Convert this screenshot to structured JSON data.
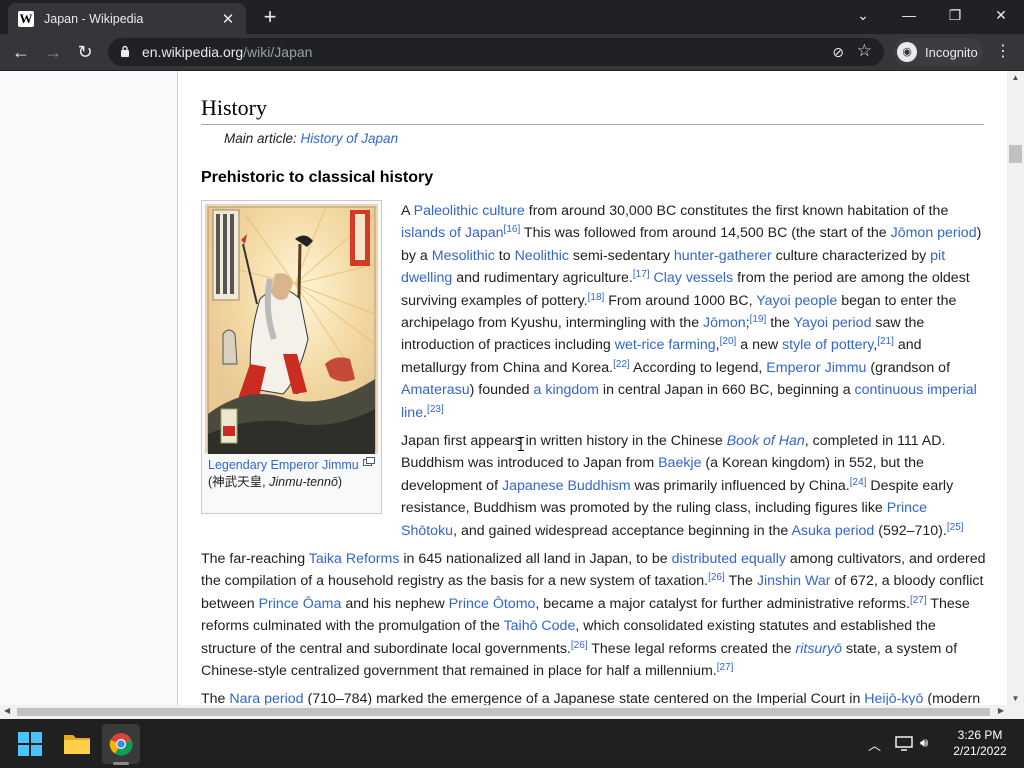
{
  "browser": {
    "tab_title": "Japan - Wikipedia",
    "favicon_letter": "W",
    "url_host": "en.wikipedia.org",
    "url_path": "/wiki/Japan",
    "incognito_label": "Incognito"
  },
  "article": {
    "section_title": "History",
    "hatnote_prefix": "Main article: ",
    "hatnote_link": "History of Japan",
    "subsection_title": "Prehistoric to classical history",
    "caption_link": "Legendary Emperor Jimmu",
    "caption_rest_1": " (神武天皇, ",
    "caption_italic": "Jinmu-tennō",
    "caption_rest_2": ")"
  },
  "taskbar": {
    "time": "3:26 PM",
    "date": "2/21/2022"
  },
  "colors": {
    "link": "#3366cc",
    "text": "#202122",
    "chrome_dark": "#202124",
    "chrome_toolbar": "#35363a"
  }
}
